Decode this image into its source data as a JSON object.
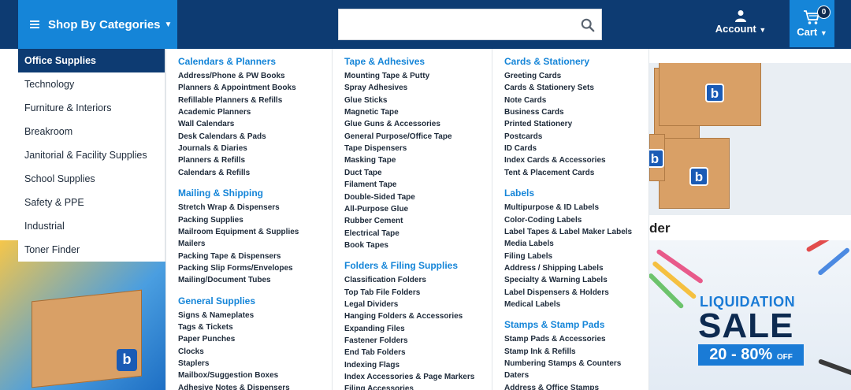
{
  "header": {
    "categories_label": "Shop By Categories",
    "search_placeholder": "",
    "account_label": "Account",
    "cart_label": "Cart",
    "cart_count": "0"
  },
  "sidebar": {
    "items": [
      {
        "label": "Office Supplies"
      },
      {
        "label": "Technology"
      },
      {
        "label": "Furniture & Interiors"
      },
      {
        "label": "Breakroom"
      },
      {
        "label": "Janitorial & Facility Supplies"
      },
      {
        "label": "School Supplies"
      },
      {
        "label": "Safety & PPE"
      },
      {
        "label": "Industrial"
      },
      {
        "label": "Toner Finder"
      }
    ]
  },
  "menu": {
    "columns": [
      {
        "sections": [
          {
            "title": "Calendars & Planners",
            "items": [
              "Address/Phone & PW Books",
              "Planners & Appointment Books",
              "Refillable Planners & Refills",
              "Academic Planners",
              "Wall Calendars",
              "Desk Calendars & Pads",
              "Journals & Diaries",
              "Planners & Refills",
              "Calendars & Refills"
            ]
          },
          {
            "title": "Mailing & Shipping",
            "items": [
              "Stretch Wrap & Dispensers",
              "Packing Supplies",
              "Mailroom Equipment & Supplies",
              "Mailers",
              "Packing Tape & Dispensers",
              "Packing Slip Forms/Envelopes",
              "Mailing/Document Tubes"
            ]
          },
          {
            "title": "General Supplies",
            "items": [
              "Signs & Nameplates",
              "Tags & Tickets",
              "Paper Punches",
              "Clocks",
              "Staplers",
              "Mailbox/Suggestion Boxes",
              "Adhesive Notes & Dispensers"
            ]
          }
        ]
      },
      {
        "sections": [
          {
            "title": "Tape & Adhesives",
            "items": [
              "Mounting Tape & Putty",
              "Spray Adhesives",
              "Glue Sticks",
              "Magnetic Tape",
              "Glue Guns & Accessories",
              "General Purpose/Office Tape",
              "Tape Dispensers",
              "Masking Tape",
              "Duct Tape",
              "Filament Tape",
              "Double-Sided Tape",
              "All-Purpose Glue",
              "Rubber Cement",
              "Electrical Tape",
              "Book Tapes"
            ]
          },
          {
            "title": "Folders & Filing Supplies",
            "items": [
              "Classification Folders",
              "Top Tab File Folders",
              "Legal Dividers",
              "Hanging Folders & Accessories",
              "Expanding Files",
              "Fastener Folders",
              "End Tab Folders",
              "Indexing Flags",
              "Index Accessories & Page Markers",
              "Filing Accessories"
            ]
          }
        ]
      },
      {
        "sections": [
          {
            "title": "Cards & Stationery",
            "items": [
              "Greeting Cards",
              "Cards & Stationery Sets",
              "Note Cards",
              "Business Cards",
              "Printed Stationery",
              "Postcards",
              "ID Cards",
              "Index Cards & Accessories",
              "Tent & Placement Cards"
            ]
          },
          {
            "title": "Labels",
            "items": [
              "Multipurpose & ID Labels",
              "Color-Coding Labels",
              "Label Tapes & Label Maker Labels",
              "Media Labels",
              "Filing Labels",
              "Address / Shipping Labels",
              "Specialty & Warning Labels",
              "Label Dispensers & Holders",
              "Medical Labels"
            ]
          },
          {
            "title": "Stamps & Stamp Pads",
            "items": [
              "Stamp Pads & Accessories",
              "Stamp Ink & Refills",
              "Numbering Stamps & Counters",
              "Daters",
              "Address & Office Stamps"
            ]
          }
        ]
      }
    ]
  },
  "banners": {
    "finder_text_partial": "der",
    "liquidation_label": "LIQUIDATION",
    "sale_label": "SALE",
    "discount_label": "20 - 80%",
    "discount_suffix": "OFF",
    "box_logo_letter": "b"
  },
  "colors": {
    "header_bg": "#0d3b72",
    "accent_blue": "#1585d8",
    "section_heading": "#1585d8",
    "sidebar_active_bg": "#0d3b72"
  },
  "icons": {
    "menu": "hamburger-icon",
    "search": "search-icon",
    "account": "user-icon",
    "cart": "cart-icon"
  }
}
